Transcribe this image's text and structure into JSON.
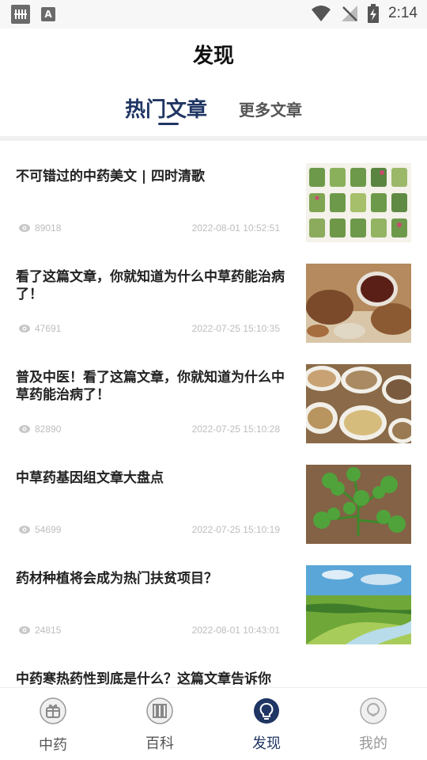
{
  "status_bar": {
    "time": "2:14",
    "left_icon_1": "signal-app-icon",
    "left_icon_2": "a-icon"
  },
  "header": {
    "title": "发现"
  },
  "tabs": {
    "active": "热门文章",
    "more": "更多文章"
  },
  "articles": [
    {
      "title": "不可错过的中药美文 | 四时清歌",
      "views": "89018",
      "date": "2022-08-01 10:52:51",
      "thumb": "herb-chart-image"
    },
    {
      "title": "看了这篇文章，你就知道为什么中草药能治病了！",
      "views": "47691",
      "date": "2022-07-25 15:10:35",
      "thumb": "herbal-tea-image"
    },
    {
      "title": "普及中医！看了这篇文章，你就知道为什么中草药能治病了！",
      "views": "82890",
      "date": "2022-07-25 15:10:28",
      "thumb": "herb-bowls-image"
    },
    {
      "title": "中草药基因组文章大盘点",
      "views": "54699",
      "date": "2022-07-25 15:10:19",
      "thumb": "green-plant-image"
    },
    {
      "title": "药材种植将会成为热门扶贫项目？",
      "views": "24815",
      "date": "2022-08-01 10:43:01",
      "thumb": "river-landscape-image"
    },
    {
      "title": "中药寒热药性到底是什么？这篇文章告诉你",
      "views": "",
      "date": "",
      "thumb": "spectrum-chart-image"
    }
  ],
  "bottom_nav": [
    {
      "label": "中药",
      "icon": "gift-icon",
      "active": false
    },
    {
      "label": "百科",
      "icon": "books-icon",
      "active": false
    },
    {
      "label": "发现",
      "icon": "bulb-icon",
      "active": true
    },
    {
      "label": "我的",
      "icon": "user-icon",
      "active": false
    }
  ],
  "colors": {
    "accent": "#1f3563",
    "meta": "#bdbdbd",
    "divider": "#f0f0f0"
  }
}
